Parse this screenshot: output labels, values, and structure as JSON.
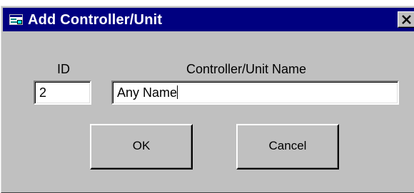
{
  "window": {
    "title": "Add Controller/Unit"
  },
  "form": {
    "id_label": "ID",
    "name_label": "Controller/Unit Name",
    "id_value": "2",
    "name_value": "Any Name"
  },
  "buttons": {
    "ok_label": "OK",
    "cancel_label": "Cancel"
  },
  "icons": {
    "title_icon": "app-window-icon",
    "close_icon": "close-icon"
  },
  "colors": {
    "titlebar": "#000080",
    "dialog_face": "#c0c0c0",
    "title_text": "#ffffff"
  }
}
